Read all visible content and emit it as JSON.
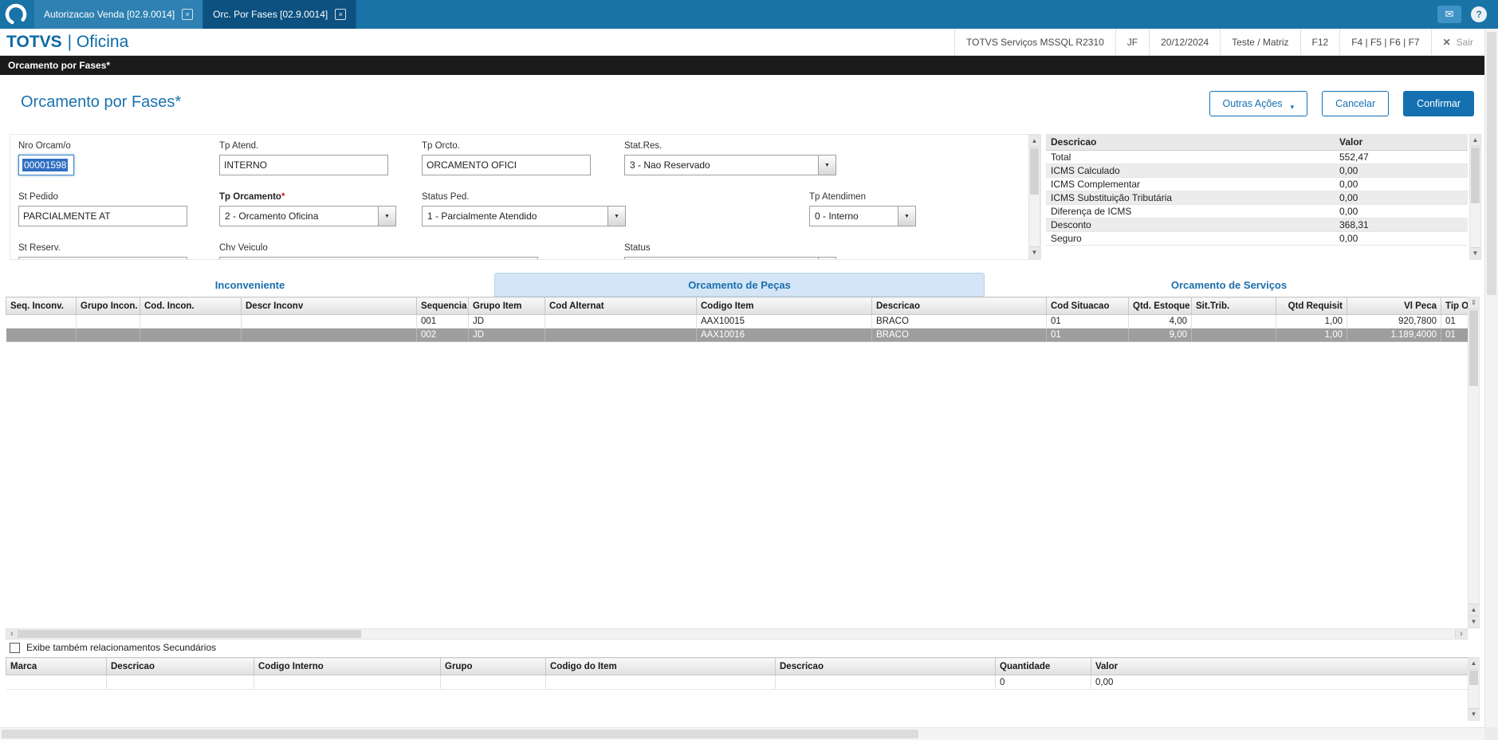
{
  "colors": {
    "brand_blue": "#1973a6",
    "active_tab_blue": "#0d5180",
    "accent": "#1470b0",
    "selected_row_gray": "#9e9e9e",
    "required_red": "#d22020",
    "text_selection_blue": "#2f6fc1",
    "active_main_tab_bg": "#d3e5f6"
  },
  "icons": {
    "mail": "✉",
    "help": "?",
    "close": "×",
    "sair_x": "✕",
    "chevron_down": "▼",
    "caret": "▾",
    "scroll_up": "▲",
    "scroll_down": "▼",
    "scroll_left": "‹",
    "scroll_right": "›",
    "updown": "⇕"
  },
  "topbar": {
    "tabs": [
      {
        "label": "Autorizacao Venda [02.9.0014]"
      },
      {
        "label": "Orc. Por Fases [02.9.0014]"
      }
    ]
  },
  "header": {
    "brand": {
      "name": "TOTVS",
      "module": "| Oficina"
    },
    "items": {
      "env": "TOTVS Serviços MSSQL R2310",
      "user": "JF",
      "date": "20/12/2024",
      "company": "Teste / Matriz",
      "f12": "F12",
      "fkeys": "F4 | F5 | F6 | F7",
      "sair": "Sair"
    }
  },
  "breadcrumb": "Orcamento por Fases*",
  "page": {
    "title": "Orcamento por Fases*",
    "buttons": {
      "outras_acoes": "Outras Ações",
      "cancelar": "Cancelar",
      "confirmar": "Confirmar"
    }
  },
  "form": {
    "nro_orcam": {
      "label": "Nro Orcam/o",
      "value": "00001598"
    },
    "tp_atend": {
      "label": "Tp Atend.",
      "value": "INTERNO"
    },
    "tp_orcto": {
      "label": "Tp Orcto.",
      "value": "ORCAMENTO OFICI"
    },
    "stat_res": {
      "label": "Stat.Res.",
      "value": "3 - Nao Reservado"
    },
    "st_pedido": {
      "label": "St Pedido",
      "value": "PARCIALMENTE AT"
    },
    "tp_orcamento": {
      "label": "Tp Orcamento",
      "required_mark": "*",
      "value": "2 - Orcamento Oficina"
    },
    "status_ped": {
      "label": "Status Ped.",
      "value": "1 - Parcialmente Atendido"
    },
    "tp_atendimen": {
      "label": "Tp Atendimen",
      "value": "0 - Interno"
    },
    "st_reserv": {
      "label": "St Reserv.",
      "value": ""
    },
    "chv_veiculo": {
      "label": "Chv Veiculo",
      "value": ""
    },
    "status": {
      "label": "Status",
      "value": ""
    }
  },
  "summary": {
    "col_desc": "Descricao",
    "col_valor": "Valor",
    "rows": [
      [
        "Total",
        "552,47"
      ],
      [
        "ICMS Calculado",
        "0,00"
      ],
      [
        "ICMS Complementar",
        "0,00"
      ],
      [
        "ICMS Substituição Tributária",
        "0,00"
      ],
      [
        "Diferença de ICMS",
        "0,00"
      ],
      [
        "Desconto",
        "368,31"
      ],
      [
        "Seguro",
        "0,00"
      ]
    ]
  },
  "tabs": {
    "inconveniente": "Inconveniente",
    "pecas": "Orcamento de Peças",
    "servicos": "Orcamento de Serviços"
  },
  "grid": {
    "headers": [
      "Seq. Inconv.",
      "Grupo Incon.",
      "Cod. Incon.",
      "Descr Inconv",
      "Sequencia",
      "Grupo Item",
      "Cod Alternat",
      "Codigo Item",
      "Descricao",
      "Cod Situacao",
      "Qtd. Estoque",
      "Sit.Trib.",
      "Qtd Requisit",
      "Vl Peca",
      "Tip Op"
    ],
    "rows": [
      [
        "",
        "",
        "",
        "",
        "001",
        "JD",
        "",
        "AAX10015",
        "BRACO",
        "01",
        "4,00",
        "",
        "1,00",
        "920,7800",
        "01"
      ],
      [
        "",
        "",
        "",
        "",
        "002",
        "JD",
        "",
        "AAX10016",
        "BRACO",
        "01",
        "9,00",
        "",
        "1,00",
        "1.189,4000",
        "01"
      ]
    ]
  },
  "secondary": {
    "checkbox_label": "Exibe também relacionamentos Secundários",
    "headers": [
      "Marca",
      "Descricao",
      "Codigo Interno",
      "Grupo",
      "Codigo do Item",
      "Descricao",
      "Quantidade",
      "Valor"
    ],
    "row": [
      "",
      "",
      "",
      "",
      "",
      "",
      "0",
      "0,00"
    ]
  }
}
